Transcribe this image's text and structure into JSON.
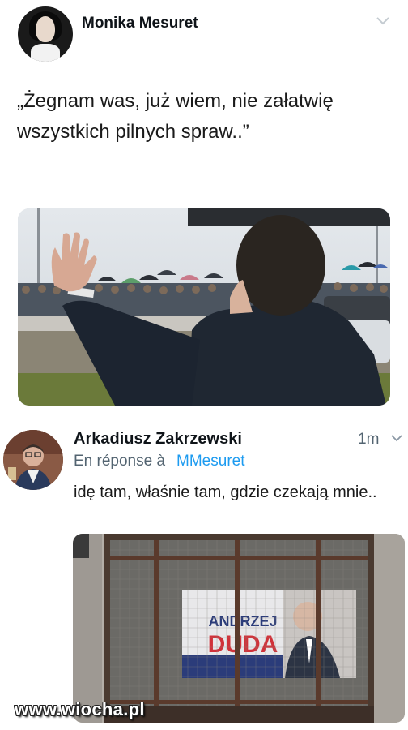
{
  "tweet1": {
    "author": "Monika Mesuret",
    "text": "„Żegnam was, już wiem, nie załatwię wszystkich pilnych spraw..”",
    "icon": "chevron-down-icon",
    "photo": "man-waving-at-crowd-with-umbrellas"
  },
  "tweet2": {
    "author": "Arkadiusz Zakrzewski",
    "time": "1m",
    "reply_prefix": "En réponse à",
    "reply_handle": "MMesuret",
    "text": "idę tam, właśnie tam, gdzie czekają mnie..",
    "icon": "chevron-down-icon",
    "photo": "campaign-poster-behind-barred-window",
    "poster_text": "ANDRZEJ DUDA"
  },
  "watermark": "www.wiocha.pl",
  "colors": {
    "link": "#1d9bf0",
    "muted": "#536471",
    "text": "#0f1419"
  }
}
